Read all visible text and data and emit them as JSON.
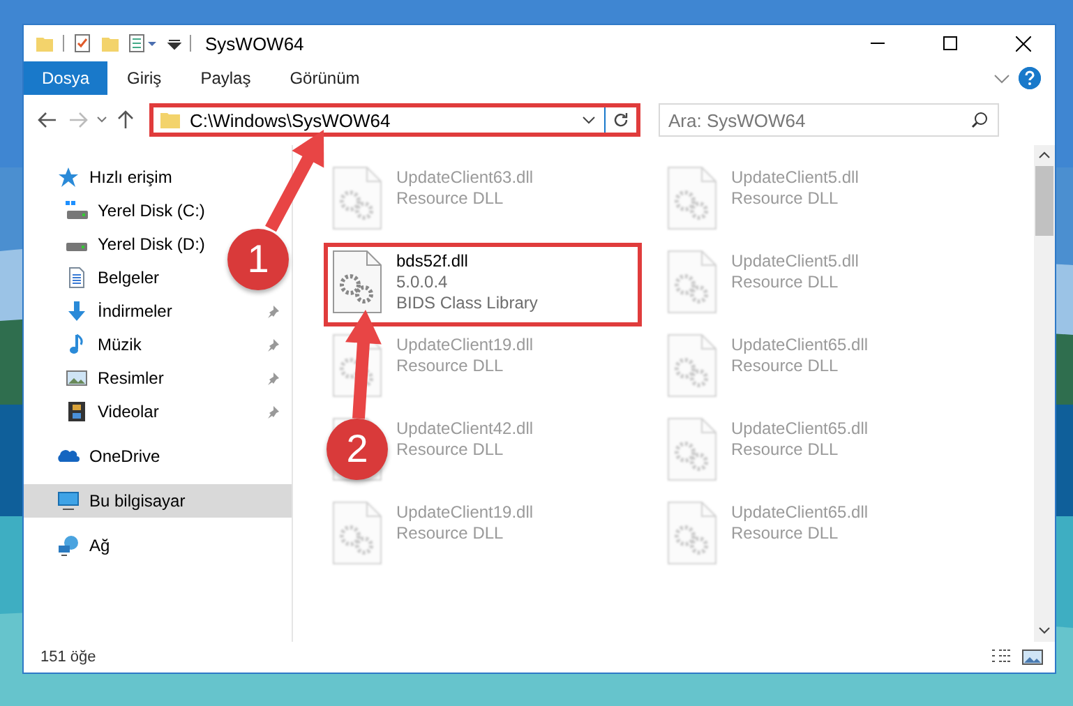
{
  "window": {
    "title": "SysWOW64"
  },
  "ribbon_tabs": [
    {
      "label": "Dosya",
      "selected": true
    },
    {
      "label": "Giriş",
      "selected": false
    },
    {
      "label": "Paylaş",
      "selected": false
    },
    {
      "label": "Görünüm",
      "selected": false
    }
  ],
  "address_bar": {
    "path": "C:\\Windows\\SysWOW64",
    "highlighted": true
  },
  "search": {
    "placeholder": "Ara: SysWOW64"
  },
  "sidebar": {
    "sections": [
      {
        "label": "Hızlı erişim",
        "kind": "star",
        "selected": false,
        "children": [
          {
            "label": "Yerel Disk (C:)",
            "kind": "system-drive",
            "pinned": false
          },
          {
            "label": "Yerel Disk (D:)",
            "kind": "drive",
            "pinned": false
          },
          {
            "label": "Belgeler",
            "kind": "document",
            "pinned": false
          },
          {
            "label": "İndirmeler",
            "kind": "download",
            "pinned": true
          },
          {
            "label": "Müzik",
            "kind": "music",
            "pinned": true
          },
          {
            "label": "Resimler",
            "kind": "pictures",
            "pinned": true
          },
          {
            "label": "Videolar",
            "kind": "videos",
            "pinned": true
          }
        ]
      },
      {
        "label": "OneDrive",
        "kind": "cloud",
        "selected": false
      },
      {
        "label": "Bu bilgisayar",
        "kind": "computer",
        "selected": true
      },
      {
        "label": "Ağ",
        "kind": "network",
        "selected": false
      }
    ]
  },
  "files": [
    {
      "name": "UpdateClient63.dll",
      "description": "Resource DLL",
      "blurred": true,
      "highlighted": false
    },
    {
      "name": "UpdateClient5.dll",
      "description": "Resource DLL",
      "blurred": true,
      "highlighted": false
    },
    {
      "name": "bds52f.dll",
      "version": "5.0.0.4",
      "description": "BIDS Class Library",
      "blurred": false,
      "highlighted": true
    },
    {
      "name": "UpdateClient5.dll",
      "description": "Resource DLL",
      "blurred": true,
      "highlighted": false
    },
    {
      "name": "UpdateClient19.dll",
      "description": "Resource DLL",
      "blurred": true,
      "highlighted": false
    },
    {
      "name": "UpdateClient65.dll",
      "description": "Resource DLL",
      "blurred": true,
      "highlighted": false
    },
    {
      "name": "UpdateClient42.dll",
      "description": "Resource DLL",
      "blurred": true,
      "highlighted": false
    },
    {
      "name": "UpdateClient65.dll",
      "description": "Resource DLL",
      "blurred": true,
      "highlighted": false
    },
    {
      "name": "UpdateClient19.dll",
      "description": "Resource DLL",
      "blurred": true,
      "highlighted": false
    },
    {
      "name": "UpdateClient65.dll",
      "description": "Resource DLL",
      "blurred": true,
      "highlighted": false
    }
  ],
  "status_bar": {
    "item_count": "151 öğe"
  },
  "annotations": [
    {
      "label": "1"
    },
    {
      "label": "2"
    }
  ]
}
